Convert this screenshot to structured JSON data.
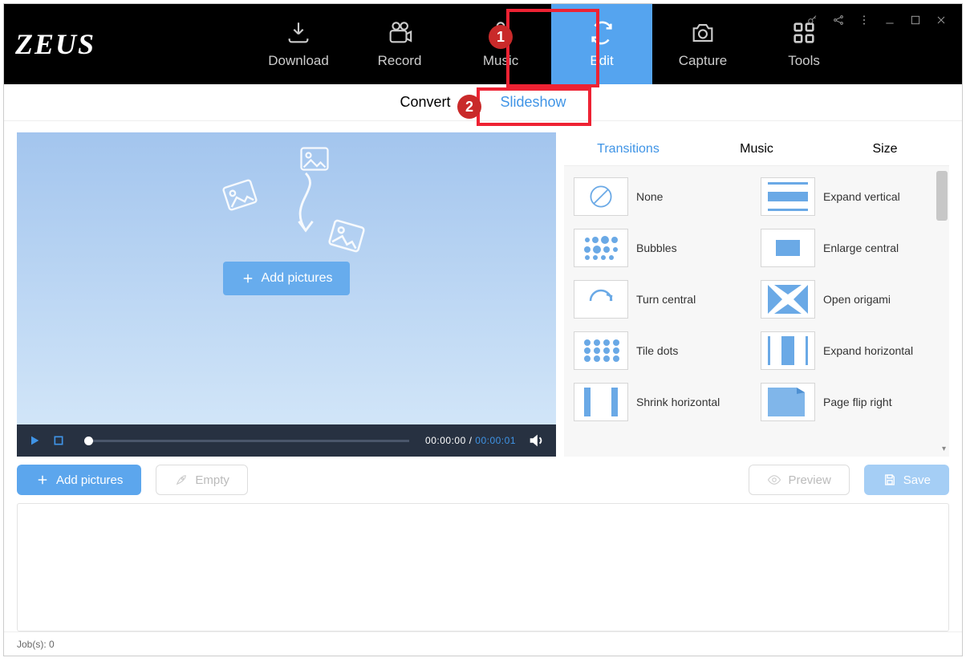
{
  "app": {
    "logo": "ZEUS"
  },
  "nav": [
    {
      "label": "Download"
    },
    {
      "label": "Record"
    },
    {
      "label": "Music"
    },
    {
      "label": "Edit",
      "active": true
    },
    {
      "label": "Capture"
    },
    {
      "label": "Tools"
    }
  ],
  "subnav": {
    "convert": "Convert",
    "slideshow": "Slideshow"
  },
  "center_button": "Add pictures",
  "player": {
    "current": "00:00:00",
    "total": "00:00:01"
  },
  "right_tabs": {
    "transitions": "Transitions",
    "music": "Music",
    "size": "Size"
  },
  "transitions": [
    {
      "label": "None"
    },
    {
      "label": "Expand vertical"
    },
    {
      "label": "Bubbles"
    },
    {
      "label": "Enlarge central"
    },
    {
      "label": "Turn central"
    },
    {
      "label": "Open origami"
    },
    {
      "label": "Tile dots"
    },
    {
      "label": "Expand horizontal"
    },
    {
      "label": "Shrink horizontal"
    },
    {
      "label": "Page flip right"
    }
  ],
  "buttons": {
    "add": "Add pictures",
    "empty": "Empty",
    "preview": "Preview",
    "save": "Save"
  },
  "status": {
    "jobs_label": "Job(s):",
    "jobs_count": "0"
  },
  "annotations": {
    "n1": "1",
    "n2": "2"
  }
}
